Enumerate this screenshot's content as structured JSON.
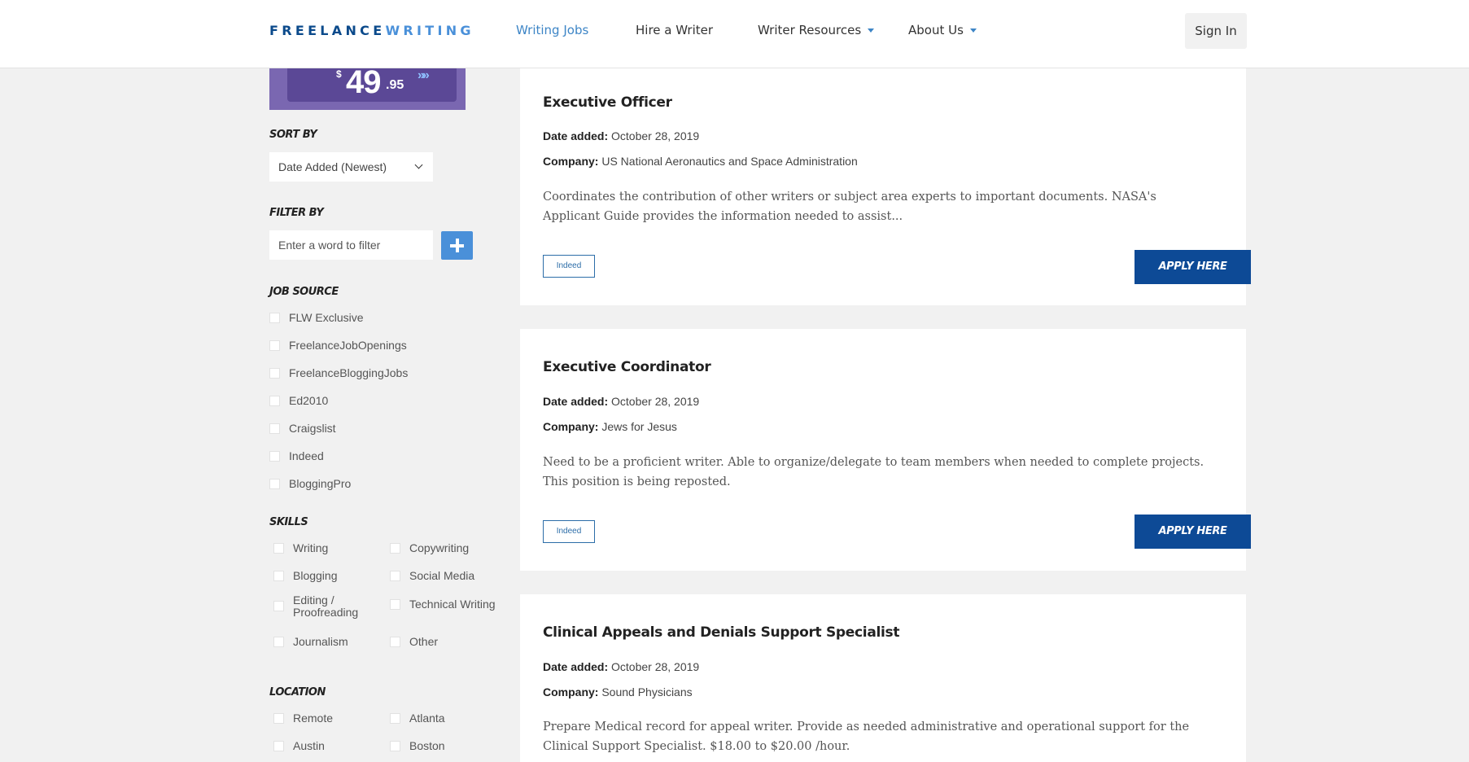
{
  "header": {
    "logo_part1": "FREELANCE",
    "logo_part2": "WRITING",
    "nav": [
      {
        "label": "Writing Jobs"
      },
      {
        "label": "Hire a Writer"
      },
      {
        "label": "Writer Resources"
      },
      {
        "label": "About Us"
      }
    ],
    "signin_label": "Sign In"
  },
  "promo": {
    "dollar": "$",
    "price": "49",
    "cents": ".95",
    "arrow": "»»"
  },
  "sidebar": {
    "sort_heading": "SORT BY",
    "sort_value": "Date Added (Newest)",
    "filter_heading": "FILTER BY",
    "filter_placeholder": "Enter a word to filter",
    "job_source_heading": "JOB SOURCE",
    "job_sources": [
      "FLW Exclusive",
      "FreelanceJobOpenings",
      "FreelanceBloggingJobs",
      "Ed2010",
      "Craigslist",
      "Indeed",
      "BloggingPro"
    ],
    "skills_heading": "SKILLS",
    "skills": [
      "Writing",
      "Copywriting",
      "Blogging",
      "Social Media",
      "Editing / Proofreading",
      "Technical Writing",
      "Journalism",
      "Other"
    ],
    "location_heading": "LOCATION",
    "locations": [
      "Remote",
      "Atlanta",
      "Austin",
      "Boston"
    ]
  },
  "jobs": [
    {
      "title": "Executive Officer",
      "date_label": "Date added:",
      "date": "October 28, 2019",
      "company_label": "Company:",
      "company": "US National Aeronautics and Space Administration",
      "description": "Coordinates the contribution of other writers or subject area experts to important documents. NASA's Applicant Guide provides the information needed to assist...",
      "source": "Indeed",
      "apply_label": "APPLY HERE"
    },
    {
      "title": "Executive Coordinator",
      "date_label": "Date added:",
      "date": "October 28, 2019",
      "company_label": "Company:",
      "company": "Jews for Jesus",
      "description": "Need to be a proficient writer. Able to organize/delegate to team members when needed to complete projects. This position is being reposted.",
      "source": "Indeed",
      "apply_label": "APPLY HERE"
    },
    {
      "title": "Clinical Appeals and Denials Support Specialist",
      "date_label": "Date added:",
      "date": "October 28, 2019",
      "company_label": "Company:",
      "company": "Sound Physicians",
      "description": "Prepare Medical record for appeal writer. Provide as needed administrative and operational support for the Clinical Support Specialist. $18.00 to $20.00 /hour."
    }
  ],
  "colors": {
    "brand_dark": "#0b4a8b",
    "brand_light": "#4a90d9",
    "apply_button": "#0d4a96",
    "promo": "#7a67b1"
  }
}
